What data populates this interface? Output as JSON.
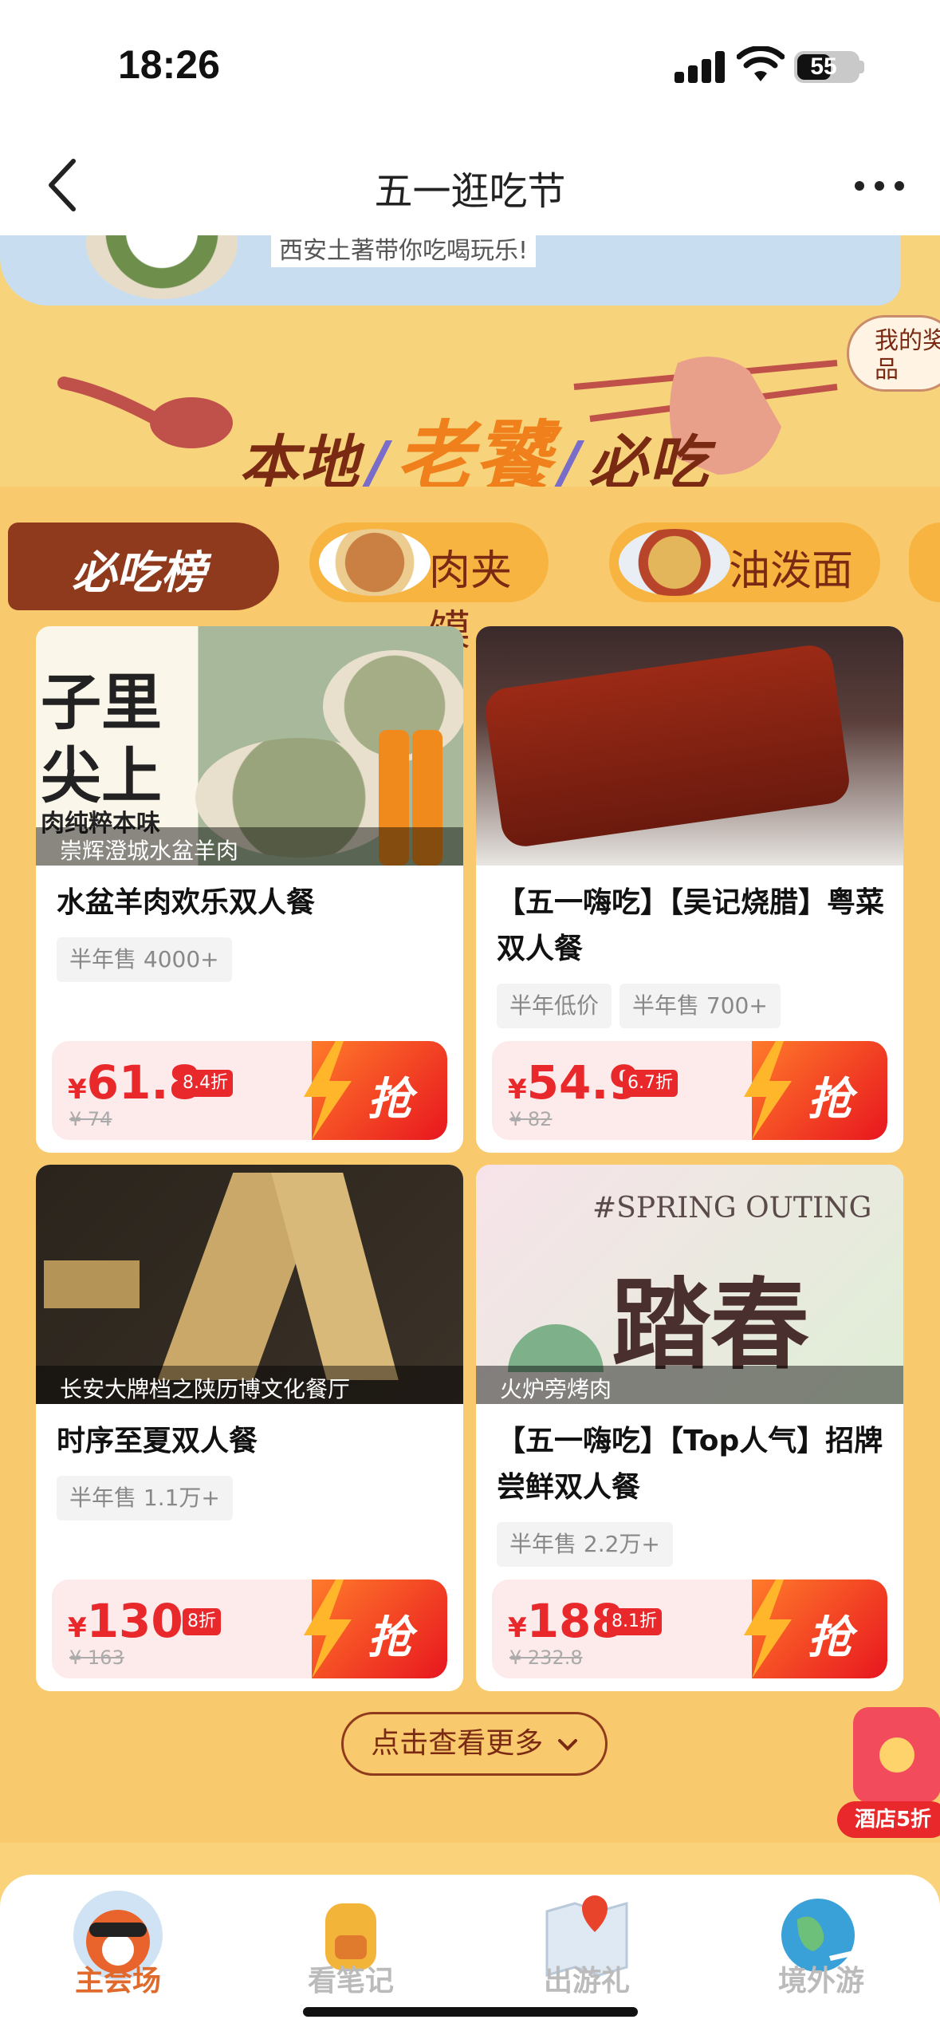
{
  "status_bar": {
    "time": "18:26",
    "battery": "55"
  },
  "nav": {
    "title": "五一逛吃节"
  },
  "hero": {
    "banner_text": "西安土著带你吃喝玩乐!",
    "title_left": "本地",
    "title_mid": "老饕",
    "title_right": "必吃",
    "prize_button": "我的奖品"
  },
  "category_tabs": [
    {
      "label": "必吃榜",
      "active": true
    },
    {
      "label": "肉夹馍",
      "active": false
    },
    {
      "label": "油泼面",
      "active": false
    }
  ],
  "products": [
    {
      "shop": "崇辉澄城水盆羊肉",
      "title": "水盆羊肉欢乐双人餐",
      "tags": [
        "半年售 4000+"
      ],
      "currency": "¥",
      "price": "61.8",
      "discount": "8.4折",
      "original_price": "¥ 74",
      "button": "抢",
      "image_text": [
        "子里",
        "尖上",
        "肉纯粹本味"
      ]
    },
    {
      "shop": "",
      "title": "【五一嗨吃】【吴记烧腊】粤菜双人餐",
      "tags": [
        "半年低价",
        "半年售 700+"
      ],
      "currency": "¥",
      "price": "54.9",
      "discount": "6.7折",
      "original_price": "¥ 82",
      "button": "抢"
    },
    {
      "shop": "长安大牌档之陕历博文化餐厅",
      "title": "时序至夏双人餐",
      "tags": [
        "半年售 1.1万+"
      ],
      "currency": "¥",
      "price": "130",
      "discount": "8折",
      "original_price": "¥ 163",
      "button": "抢"
    },
    {
      "shop": "火炉旁烤肉",
      "title": "【五一嗨吃】【Top人气】招牌尝鲜双人餐",
      "tags": [
        "半年售 2.2万+"
      ],
      "currency": "¥",
      "price": "188",
      "discount": "8.1折",
      "original_price": "¥ 232.8",
      "button": "抢",
      "image_text": [
        "#SPRING OUTING",
        "踏春"
      ]
    }
  ],
  "more_button": "点击查看更多",
  "float_badge": "酒店5折",
  "tabbar": [
    {
      "label": "主会场",
      "icon": "red-panda-icon",
      "active": true
    },
    {
      "label": "看笔记",
      "icon": "backpack-icon",
      "active": false
    },
    {
      "label": "出游礼",
      "icon": "map-pin-icon",
      "active": false
    },
    {
      "label": "境外游",
      "icon": "globe-plane-icon",
      "active": false
    }
  ],
  "colors": {
    "accent": "#e8282a",
    "brand_brown": "#8f3a1c",
    "panel": "#f9c96d",
    "active_tab_text": "#e06a2c"
  }
}
